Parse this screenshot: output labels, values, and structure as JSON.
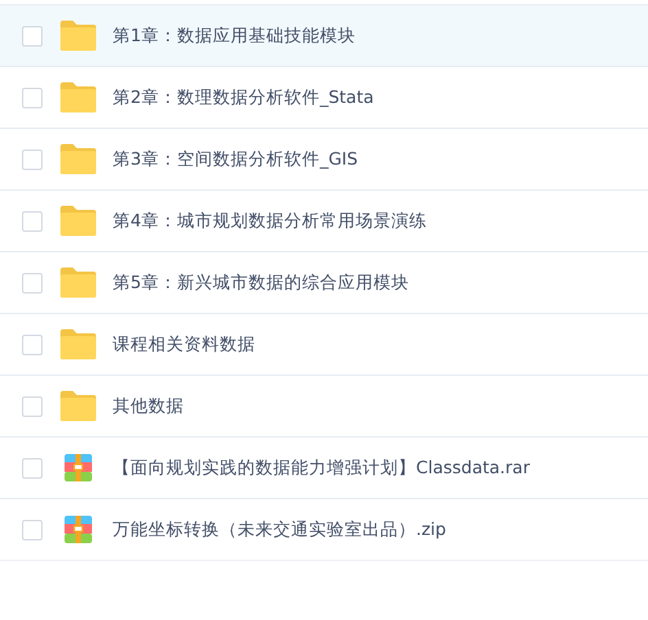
{
  "files": [
    {
      "name": "第1章：数据应用基础技能模块",
      "kind": "folder",
      "checked": false,
      "highlighted": true
    },
    {
      "name": "第2章：数理数据分析软件_Stata",
      "kind": "folder",
      "checked": false,
      "highlighted": false
    },
    {
      "name": "第3章：空间数据分析软件_GIS",
      "kind": "folder",
      "checked": false,
      "highlighted": false
    },
    {
      "name": "第4章：城市规划数据分析常用场景演练",
      "kind": "folder",
      "checked": false,
      "highlighted": false
    },
    {
      "name": "第5章：新兴城市数据的综合应用模块",
      "kind": "folder",
      "checked": false,
      "highlighted": false
    },
    {
      "name": "课程相关资料数据",
      "kind": "folder",
      "checked": false,
      "highlighted": false
    },
    {
      "name": "其他数据",
      "kind": "folder",
      "checked": false,
      "highlighted": false
    },
    {
      "name": "【面向规划实践的数据能力增强计划】Classdata.rar",
      "kind": "archive",
      "checked": false,
      "highlighted": false
    },
    {
      "name": "万能坐标转换（未来交通实验室出品）.zip",
      "kind": "archive",
      "checked": false,
      "highlighted": false
    }
  ]
}
